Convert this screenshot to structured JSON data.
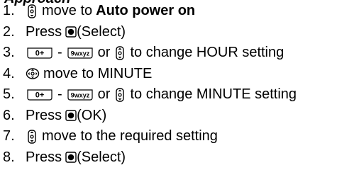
{
  "header": {
    "title": "Approach"
  },
  "steps": [
    {
      "num": "1.",
      "text": "move to",
      "bold": "Auto power on"
    },
    {
      "num": "2.",
      "text": "Press",
      "suffix": "(Select)"
    },
    {
      "num": "3.",
      "sep": "-",
      "or": "or",
      "text": "to change HOUR setting"
    },
    {
      "num": "4.",
      "text": "move to MINUTE"
    },
    {
      "num": "5.",
      "sep": "-",
      "or": "or",
      "text": "to change MINUTE setting"
    },
    {
      "num": "6.",
      "text": "Press",
      "suffix": "(OK)"
    },
    {
      "num": "7.",
      "text": "move to the required setting"
    },
    {
      "num": "8.",
      "text": "Press",
      "suffix": "(Select)"
    }
  ],
  "keys": {
    "key0_label": "0+",
    "key9_label": "9wxyz"
  },
  "icons": {
    "nav_updown": "nav-up-down-icon",
    "nav_four": "nav-four-way-icon",
    "select_key": "select-key-icon",
    "key_0": "key-0-icon",
    "key_9": "key-9-icon"
  }
}
